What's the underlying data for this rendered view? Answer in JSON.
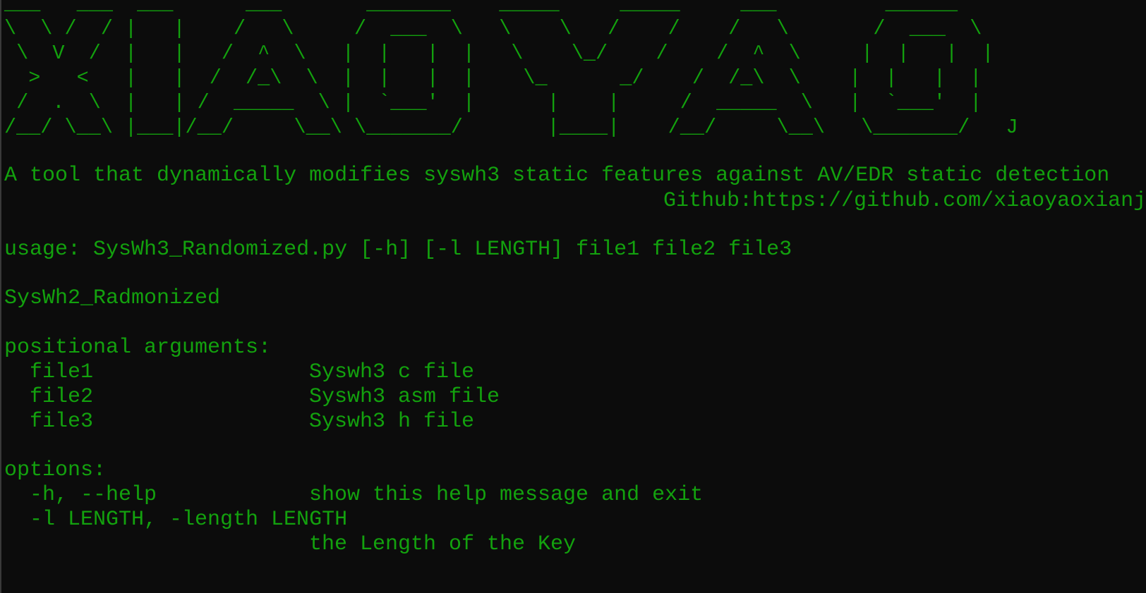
{
  "terminal": {
    "colors": {
      "background": "#0c0c0c",
      "text": "#13a10e"
    },
    "banner_lines": [
      "___   ___  ___      ___       _______    _____     _____     ___         ______",
      "\\  \\ /  / |   |    /   \\     /  ___  \\   \\    \\   /    /    /   \\       /  ___  \\",
      " \\  V  /  |   |   /  ^  \\   |  |   |  |   \\    \\_/    /    /  ^  \\     |  |   |  |",
      "  >   <   |   |  /  /_\\  \\  |  |   |  |    \\_      _/    /  /_\\  \\    |  |   |  |",
      " /  .  \\  |   | /  _____  \\ |  `___'  |      |    |     /  _____  \\   |  `___'  |",
      "/__/ \\__\\ |___|/__/     \\__\\ \\_______/       |____|    /__/     \\__\\   \\_______/   J"
    ],
    "description": "A tool that dynamically modifies syswh3 static features against AV/EDR static detection",
    "github": "Github:https://github.com/xiaoyaoxianj",
    "usage": "usage: SysWh3_Randomized.py [-h] [-l LENGTH] file1 file2 file3",
    "program_name": "SysWh2_Radmonized",
    "positional_header": "positional arguments:",
    "positional_args": [
      {
        "name": "file1",
        "desc": "Syswh3 c file"
      },
      {
        "name": "file2",
        "desc": "Syswh3 asm file"
      },
      {
        "name": "file3",
        "desc": "Syswh3 h file"
      }
    ],
    "options_header": "options:",
    "options": [
      {
        "name": "-h, --help",
        "desc": "show this help message and exit"
      },
      {
        "name": "-l LENGTH, -length LENGTH",
        "desc": ""
      }
    ],
    "length_desc": "the Length of the Key"
  }
}
